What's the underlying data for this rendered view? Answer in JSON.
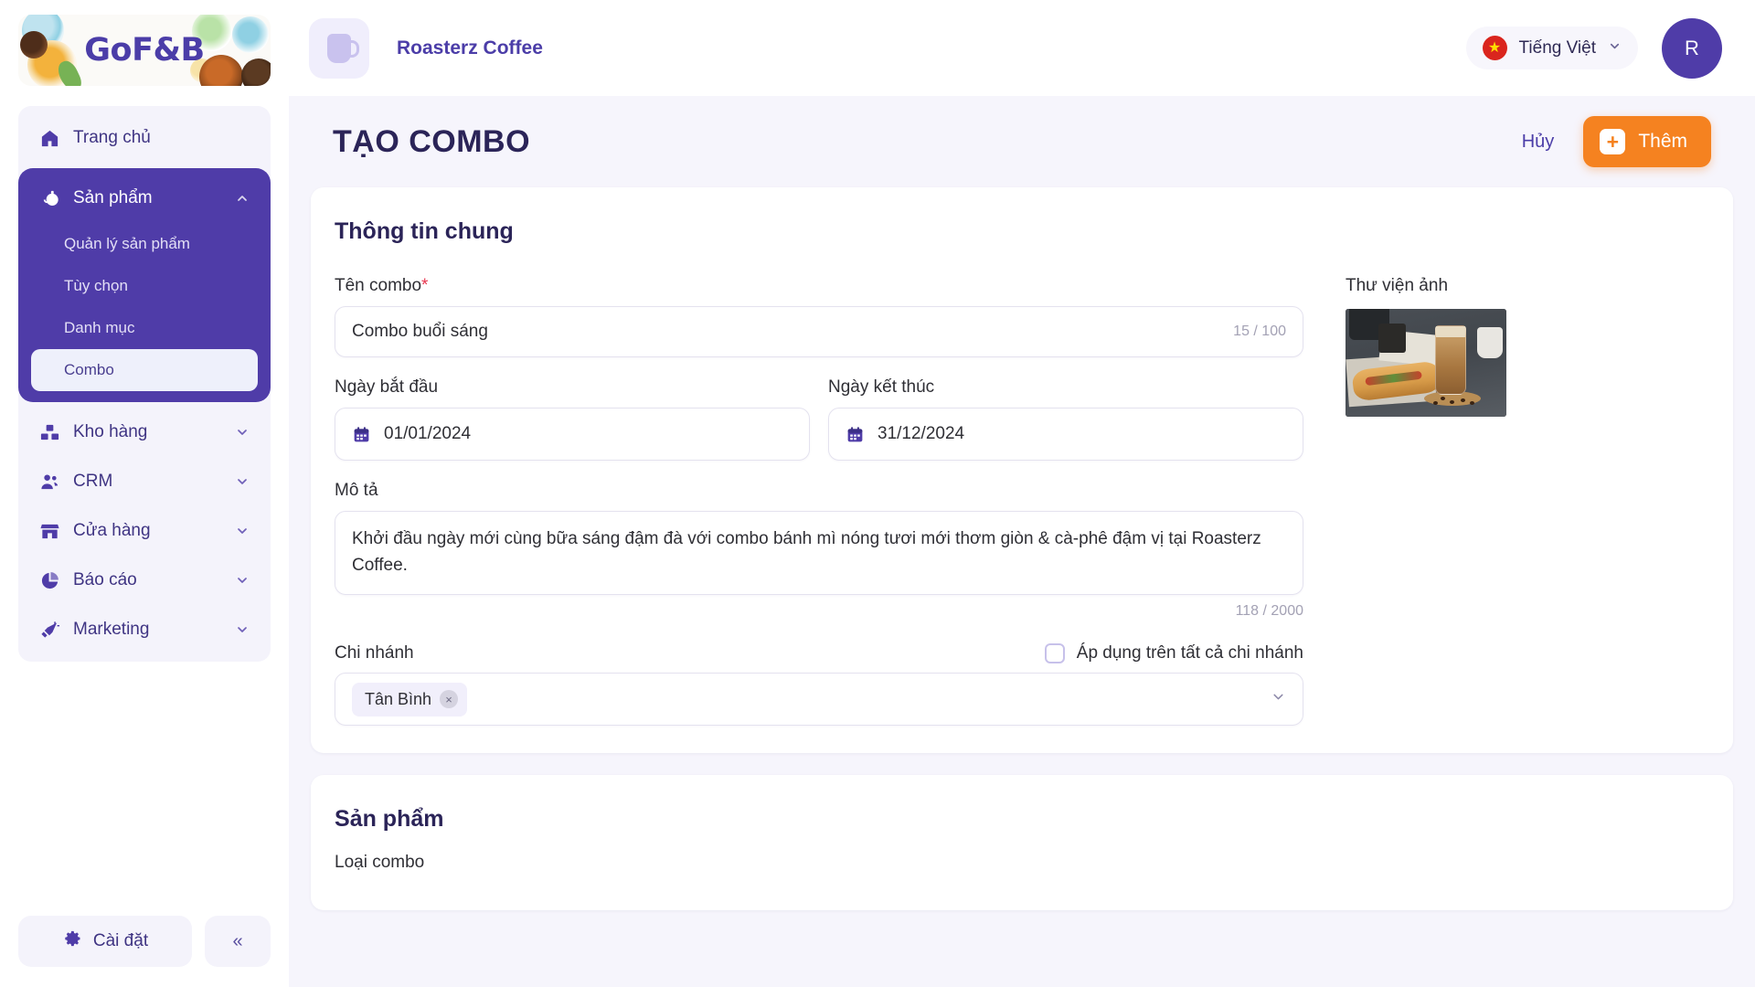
{
  "brand": {
    "logo_text": "GoF&B"
  },
  "sidebar": {
    "home": {
      "label": "Trang chủ",
      "icon": "home-icon"
    },
    "product_group": {
      "label": "Sản phẩm",
      "icon": "product-icon",
      "chevron": "chevron-up-icon",
      "children": [
        {
          "label": "Quản lý sản phẩm",
          "selected": false
        },
        {
          "label": "Tùy chọn",
          "selected": false
        },
        {
          "label": "Danh mục",
          "selected": false
        },
        {
          "label": "Combo",
          "selected": true
        }
      ]
    },
    "items": [
      {
        "label": "Kho hàng",
        "icon": "warehouse-icon",
        "chevron": "chevron-down-icon"
      },
      {
        "label": "CRM",
        "icon": "users-icon",
        "chevron": "chevron-down-icon"
      },
      {
        "label": "Cửa hàng",
        "icon": "store-icon",
        "chevron": "chevron-down-icon"
      },
      {
        "label": "Báo cáo",
        "icon": "pie-chart-icon",
        "chevron": "chevron-down-icon"
      },
      {
        "label": "Marketing",
        "icon": "megaphone-icon",
        "chevron": "chevron-down-icon"
      }
    ],
    "settings": {
      "label": "Cài đặt",
      "icon": "gear-icon"
    },
    "collapse": {
      "label": "«"
    }
  },
  "topbar": {
    "store_name": "Roasterz Coffee",
    "store_icon": "coffee-cup-icon",
    "language": {
      "label": "Tiếng Việt",
      "flag": "vietnam-flag-icon",
      "chevron": "chevron-down-icon"
    },
    "avatar_initial": "R"
  },
  "page": {
    "title": "TẠO COMBO",
    "cancel_label": "Hủy",
    "add_label": "Thêm"
  },
  "general": {
    "section_title": "Thông tin chung",
    "combo_name": {
      "label": "Tên combo",
      "required_mark": "*",
      "value": "Combo buổi sáng",
      "counter": "15 / 100"
    },
    "start_date": {
      "label": "Ngày bắt đầu",
      "value": "01/01/2024",
      "icon": "calendar-icon"
    },
    "end_date": {
      "label": "Ngày kết thúc",
      "value": "31/12/2024",
      "icon": "calendar-icon"
    },
    "description": {
      "label": "Mô tả",
      "value": "Khởi đầu ngày mới cùng bữa sáng đậm đà với combo bánh mì nóng tươi mới thơm giòn & cà-phê đậm vị tại Roasterz Coffee.",
      "counter": "118 / 2000"
    },
    "branch": {
      "label": "Chi nhánh",
      "all_branches_label": "Áp dụng trên tất cả chi nhánh",
      "all_branches_checked": false,
      "selected": [
        {
          "label": "Tân Bình",
          "remove": "×"
        }
      ],
      "chevron": "chevron-down-icon"
    },
    "gallery": {
      "label": "Thư viện ảnh",
      "image_alt": "banh-mi-and-iced-coffee-photo"
    }
  },
  "products_section": {
    "section_title": "Sản phẩm",
    "combo_type_label": "Loại combo"
  },
  "colors": {
    "brand_purple": "#4f3ca8",
    "title_navy": "#2b2458",
    "accent_orange": "#f58220",
    "required_red": "#e8364f",
    "sidebar_bg": "#f4f3fb",
    "page_bg": "#f6f5fc"
  }
}
